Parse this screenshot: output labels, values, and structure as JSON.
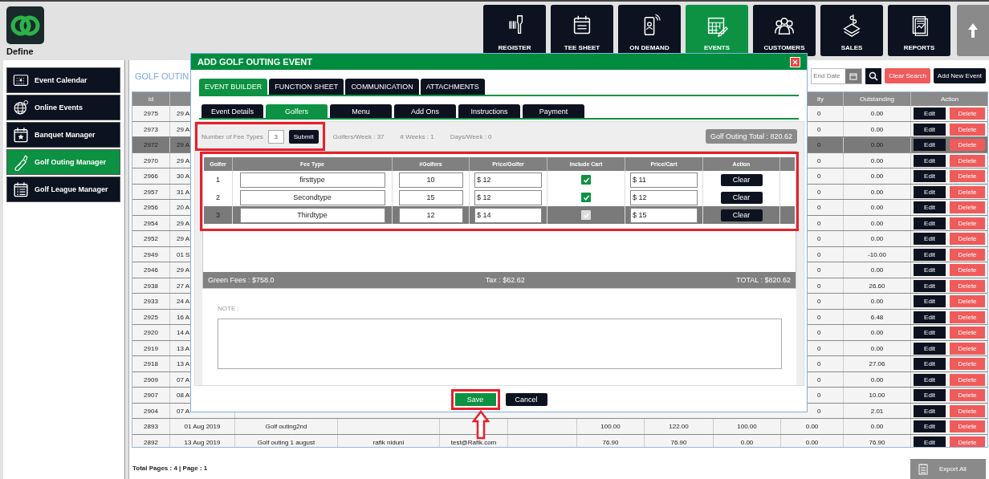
{
  "app": {
    "title": "Define"
  },
  "nav": [
    {
      "label": "REGISTER",
      "selected": false
    },
    {
      "label": "TEE SHEET",
      "selected": false
    },
    {
      "label": "ON DEMAND",
      "selected": false
    },
    {
      "label": "EVENTS",
      "selected": true
    },
    {
      "label": "CUSTOMERS",
      "selected": false
    },
    {
      "label": "SALES",
      "selected": false
    },
    {
      "label": "REPORTS",
      "selected": false
    }
  ],
  "sidebar": {
    "items": [
      {
        "label": "Event Calendar",
        "selected": false
      },
      {
        "label": "Online Events",
        "selected": false
      },
      {
        "label": "Banquet Manager",
        "selected": false
      },
      {
        "label": "Golf Outing Manager",
        "selected": true
      },
      {
        "label": "Golf League Manager",
        "selected": false
      }
    ]
  },
  "main": {
    "title": "GOLF OUTIN",
    "end_date": {
      "placeholder": "End Date"
    },
    "clear_search": "Clear Search",
    "add_new": "Add New Event",
    "columns": {
      "id": "Id",
      "column_10": "ity",
      "outstanding": "Outstanding",
      "action": "Action"
    },
    "rows": [
      {
        "kind": "covered",
        "id": "2975",
        "date": "29 A",
        "column_10": "0",
        "outstanding": "0.00",
        "edit": "Edit",
        "delete": "Delete",
        "selected": false
      },
      {
        "kind": "covered",
        "id": "2973",
        "date": "29 A",
        "column_10": "0",
        "outstanding": "0.00",
        "edit": "Edit",
        "delete": "Delete",
        "selected": false
      },
      {
        "kind": "covered",
        "id": "2972",
        "date": "29 A",
        "column_10": "0",
        "outstanding": "0.00",
        "edit": "Edit",
        "delete": "Delete",
        "selected": true
      },
      {
        "kind": "covered",
        "id": "2970",
        "date": "29 A",
        "column_10": "0",
        "outstanding": "0.00",
        "edit": "Edit",
        "delete": "Delete",
        "selected": false
      },
      {
        "kind": "covered",
        "id": "2966",
        "date": "30 A",
        "column_10": "0",
        "outstanding": "0.00",
        "edit": "Edit",
        "delete": "Delete",
        "selected": false
      },
      {
        "kind": "covered",
        "id": "2957",
        "date": "31 A",
        "column_10": "0",
        "outstanding": "0.00",
        "edit": "Edit",
        "delete": "Delete",
        "selected": false
      },
      {
        "kind": "covered",
        "id": "2956",
        "date": "20 A",
        "column_10": "0",
        "outstanding": "0.00",
        "edit": "Edit",
        "delete": "Delete",
        "selected": false
      },
      {
        "kind": "covered",
        "id": "2954",
        "date": "29 A",
        "column_10": "0",
        "outstanding": "0.00",
        "edit": "Edit",
        "delete": "Delete",
        "selected": false
      },
      {
        "kind": "covered",
        "id": "2952",
        "date": "29 A",
        "column_10": "0",
        "outstanding": "0.00",
        "edit": "Edit",
        "delete": "Delete",
        "selected": false
      },
      {
        "kind": "covered",
        "id": "2949",
        "date": "01 S",
        "column_10": "0",
        "outstanding": "-10.00",
        "edit": "Edit",
        "delete": "Delete",
        "selected": false
      },
      {
        "kind": "covered",
        "id": "2946",
        "date": "29 A",
        "column_10": "0",
        "outstanding": "0.00",
        "edit": "Edit",
        "delete": "Delete",
        "selected": false
      },
      {
        "kind": "covered",
        "id": "2938",
        "date": "27 A",
        "column_10": "0",
        "outstanding": "26.60",
        "edit": "Edit",
        "delete": "Delete",
        "selected": false
      },
      {
        "kind": "covered",
        "id": "2933",
        "date": "24 A",
        "column_10": "0",
        "outstanding": "0.00",
        "edit": "Edit",
        "delete": "Delete",
        "selected": false
      },
      {
        "kind": "covered",
        "id": "2925",
        "date": "16 A",
        "column_10": "0",
        "outstanding": "6.48",
        "edit": "Edit",
        "delete": "Delete",
        "selected": false
      },
      {
        "kind": "covered",
        "id": "2920",
        "date": "14 A",
        "column_10": "0",
        "outstanding": "0.00",
        "edit": "Edit",
        "delete": "Delete",
        "selected": false
      },
      {
        "kind": "covered",
        "id": "2919",
        "date": "13 A",
        "column_10": "0",
        "outstanding": "0.00",
        "edit": "Edit",
        "delete": "Delete",
        "selected": false
      },
      {
        "kind": "covered",
        "id": "2918",
        "date": "13 A",
        "column_10": "0",
        "outstanding": "27.06",
        "edit": "Edit",
        "delete": "Delete",
        "selected": false
      },
      {
        "kind": "covered",
        "id": "2909",
        "date": "07 A",
        "column_10": "0",
        "outstanding": "0.00",
        "edit": "Edit",
        "delete": "Delete",
        "selected": false
      },
      {
        "kind": "covered",
        "id": "2907",
        "date": "08 A",
        "column_10": "0",
        "outstanding": "10.00",
        "edit": "Edit",
        "delete": "Delete",
        "selected": false
      },
      {
        "kind": "covered",
        "id": "2904",
        "date": "07 A",
        "column_10": "0",
        "outstanding": "2.01",
        "edit": "Edit",
        "delete": "Delete",
        "selected": false
      },
      {
        "kind": "full",
        "id": "2893",
        "date": "01 Aug 2019",
        "name": "Golf outing2nd",
        "column_7": "100.00",
        "column_8": "122.00",
        "column_9": "100.00",
        "column_10": "0.00",
        "outstanding": "0.00",
        "edit": "Edit",
        "delete": "Delete",
        "selected": false
      },
      {
        "kind": "full",
        "id": "2892",
        "date": "13 Aug 2019",
        "name": "Golf outing 1 august",
        "column_4": "rafik niduni",
        "email": "test@Rafik.com",
        "column_7": "76.90",
        "column_8": "76.90",
        "column_9": "0.00",
        "column_10": "0.00",
        "outstanding": "76.90",
        "edit": "Edit",
        "delete": "Delete",
        "selected": false
      }
    ],
    "footer": "Total Pages : 4 | Page : 1",
    "export": "Export All"
  },
  "modal": {
    "title": "ADD GOLF OUTING EVENT",
    "tabs": [
      {
        "label": "EVENT BUILDER",
        "selected": true
      },
      {
        "label": "FUNCTION SHEET",
        "selected": false
      },
      {
        "label": "COMMUNICATION",
        "selected": false
      },
      {
        "label": "ATTACHMENTS",
        "selected": false
      }
    ],
    "subtabs": [
      {
        "label": "Event Details",
        "selected": false
      },
      {
        "label": "Golfers",
        "selected": true
      },
      {
        "label": "Menu",
        "selected": false
      },
      {
        "label": "Add Ons",
        "selected": false
      },
      {
        "label": "Instructions",
        "selected": false
      },
      {
        "label": "Payment",
        "selected": false
      }
    ],
    "fee_types": {
      "label": "Number of Fee Types",
      "value": "3",
      "submit": "Submit"
    },
    "stats": [
      "Golfers/Week : 37",
      "# Weeks : 1",
      "Days/Week : 0"
    ],
    "total_badge": "Golf Outing Total : 820.62",
    "fee_table": {
      "columns": [
        "Golfer",
        "Fee Type",
        "#Golfers",
        "Price/Golfer",
        "Include Cart",
        "Price/Cart",
        "Action"
      ],
      "rows": [
        {
          "golfer": "1",
          "fee_type": "firsttype",
          "golfers": "10",
          "price_golfer": "$ 12",
          "include_cart": true,
          "price_cart": "$ 11",
          "action": "Clear",
          "selected": false
        },
        {
          "golfer": "2",
          "fee_type": "Secondtype",
          "golfers": "15",
          "price_golfer": "$ 12",
          "include_cart": true,
          "price_cart": "$ 12",
          "action": "Clear",
          "selected": false
        },
        {
          "golfer": "3",
          "fee_type": "Thirdtype",
          "golfers": "12",
          "price_golfer": "$ 14",
          "include_cart": true,
          "price_cart": "$ 15",
          "action": "Clear",
          "selected": true
        }
      ]
    },
    "summary": {
      "green_fees": "Green Fees : $758.0",
      "tax": "Tax : $62.62",
      "total": "TOTAL : $820.62"
    },
    "note": {
      "label": "NOTE :"
    },
    "save": "Save",
    "cancel": "Cancel"
  }
}
